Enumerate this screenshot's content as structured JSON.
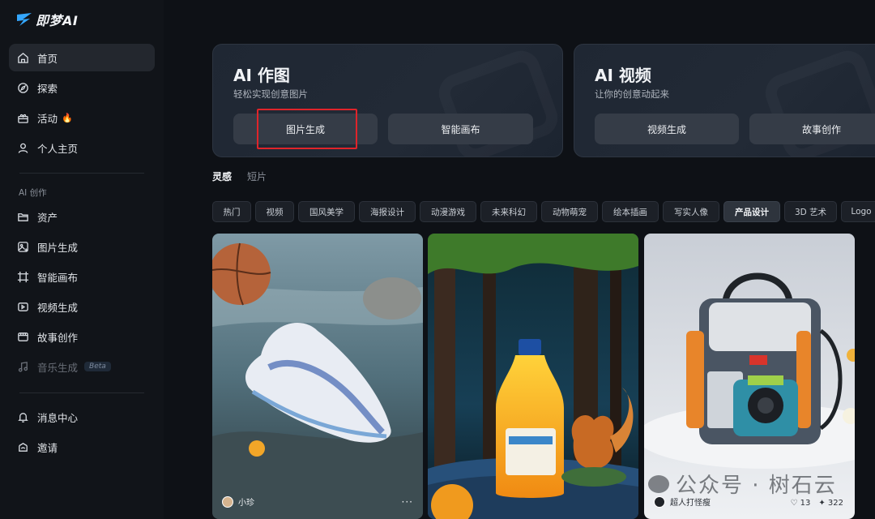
{
  "brand": {
    "name": "即梦AI"
  },
  "sidebar": {
    "items": [
      {
        "label": "首页",
        "icon": "home-icon"
      },
      {
        "label": "探索",
        "icon": "compass-icon"
      },
      {
        "label": "活动",
        "icon": "gift-icon",
        "badge": "🔥"
      },
      {
        "label": "个人主页",
        "icon": "user-icon"
      }
    ],
    "section_label": "AI 创作",
    "create_items": [
      {
        "label": "资产",
        "icon": "folder-icon"
      },
      {
        "label": "图片生成",
        "icon": "image-generate-icon"
      },
      {
        "label": "智能画布",
        "icon": "canvas-icon"
      },
      {
        "label": "视频生成",
        "icon": "video-generate-icon"
      },
      {
        "label": "故事创作",
        "icon": "story-icon"
      },
      {
        "label": "音乐生成",
        "icon": "music-icon",
        "tag": "Beta"
      }
    ],
    "bottom_items": [
      {
        "label": "消息中心",
        "icon": "bell-icon"
      },
      {
        "label": "邀请",
        "icon": "invite-icon"
      }
    ]
  },
  "cards": {
    "image": {
      "title": "AI 作图",
      "subtitle": "轻松实现创意图片",
      "buttons": [
        "图片生成",
        "智能画布"
      ]
    },
    "video": {
      "title": "AI 视频",
      "subtitle": "让你的创意动起来",
      "buttons": [
        "视频生成",
        "故事创作"
      ]
    }
  },
  "feed_tabs": [
    "灵感",
    "短片"
  ],
  "categories": [
    "热门",
    "视频",
    "国风美学",
    "海报设计",
    "动漫游戏",
    "未来科幻",
    "动物萌宠",
    "绘本插画",
    "写实人像",
    "产品设计",
    "3D 艺术",
    "Logo"
  ],
  "active_category": "产品设计",
  "tiles": [
    {
      "author": "小珍",
      "more": "···"
    },
    {
      "author": ""
    },
    {
      "author": "超人打怪瘦",
      "likes": "13",
      "uses": "322"
    }
  ],
  "watermark": "公众号 · 树石云",
  "colors": {
    "highlight": "#e0242a",
    "background": "#0e1116"
  }
}
